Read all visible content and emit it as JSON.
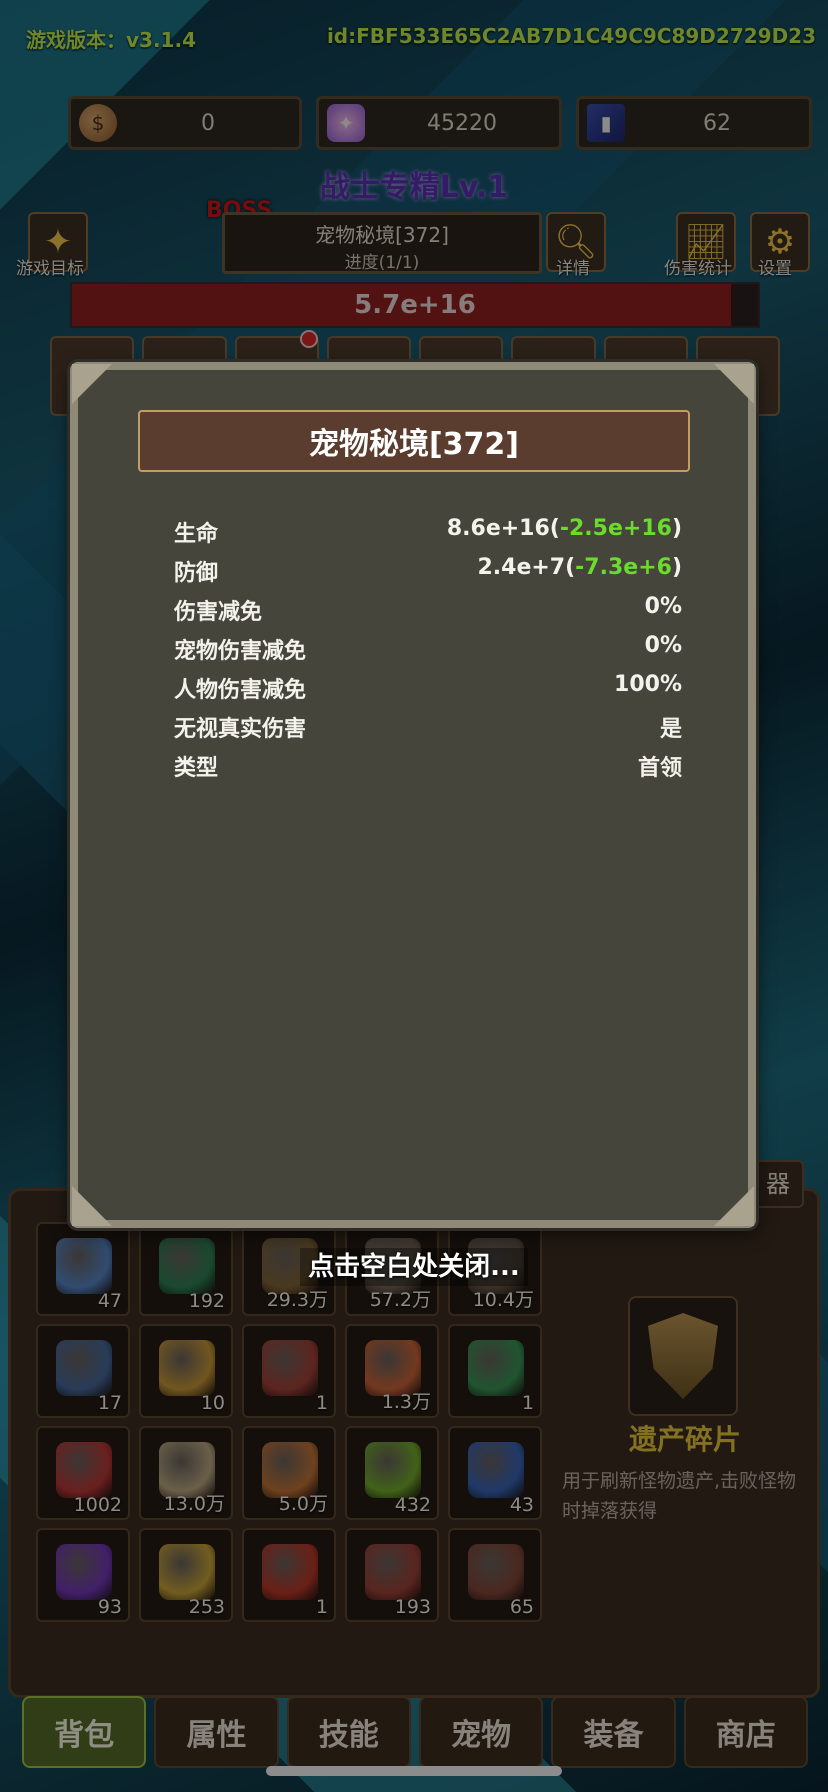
{
  "header": {
    "version_label": "游戏版本：v3.1.4",
    "user_id": "id:FBF533E65C2AB7D1C49C9C89D2729D23"
  },
  "resources": [
    {
      "icon": "coin-icon",
      "value": "0"
    },
    {
      "icon": "crystal-icon",
      "value": "45220"
    },
    {
      "icon": "card-icon",
      "value": "62"
    }
  ],
  "specialty": "战士专精Lv.1",
  "stage": {
    "boss_tag": "BOSS",
    "name": "宠物秘境[372]",
    "progress": "进度(1/1)",
    "boss_hp": "5.7e+16",
    "boss_hp_fraction": 0.96
  },
  "top_buttons": {
    "goal": "游戏目标",
    "detail": "详情",
    "damage_stats": "伤害统计",
    "settings": "设置"
  },
  "modal": {
    "title": "宠物秘境[372]",
    "stats": [
      {
        "label": "生命",
        "value": "8.6e+16(",
        "delta": "-2.5e+16",
        "close": ")"
      },
      {
        "label": "防御",
        "value": "2.4e+7(",
        "delta": "-7.3e+6",
        "close": ")"
      },
      {
        "label": "伤害减免",
        "value": "0%"
      },
      {
        "label": "宠物伤害减免",
        "value": "0%"
      },
      {
        "label": "人物伤害减免",
        "value": "100%"
      },
      {
        "label": "无视真实伤害",
        "value": "是"
      },
      {
        "label": "类型",
        "value": "首领"
      }
    ],
    "close_hint": "点击空白处关闭..."
  },
  "side_tab": "器",
  "inventory": [
    {
      "count": "47",
      "color": "#5a8fd6"
    },
    {
      "count": "192",
      "color": "#2e8a5a"
    },
    {
      "count": "29.3万",
      "color": "#8a6a3a"
    },
    {
      "count": "57.2万",
      "color": "#7a6b5a"
    },
    {
      "count": "10.4万",
      "color": "#6b5b4b"
    },
    {
      "count": "17",
      "color": "#4a6fa8"
    },
    {
      "count": "10",
      "color": "#d6a23a"
    },
    {
      "count": "1",
      "color": "#b0443a"
    },
    {
      "count": "1.3万",
      "color": "#d86a3a"
    },
    {
      "count": "1",
      "color": "#3aa05a"
    },
    {
      "count": "1002",
      "color": "#c83a3a"
    },
    {
      "count": "13.0万",
      "color": "#c8b48a"
    },
    {
      "count": "5.0万",
      "color": "#d07a3a"
    },
    {
      "count": "432",
      "color": "#7ab82e"
    },
    {
      "count": "43",
      "color": "#3a6ac8"
    },
    {
      "count": "93",
      "color": "#7a3ac8"
    },
    {
      "count": "253",
      "color": "#d6b03a"
    },
    {
      "count": "1",
      "color": "#c83a2a"
    },
    {
      "count": "193",
      "color": "#a8443a"
    },
    {
      "count": "65",
      "color": "#8a4a3a"
    }
  ],
  "item_detail": {
    "title": "遗产碎片",
    "description": "用于刷新怪物遗产,击败怪物时掉落获得"
  },
  "nav": [
    {
      "label": "背包",
      "active": true
    },
    {
      "label": "属性"
    },
    {
      "label": "技能"
    },
    {
      "label": "宠物"
    },
    {
      "label": "装备"
    },
    {
      "label": "商店"
    }
  ]
}
